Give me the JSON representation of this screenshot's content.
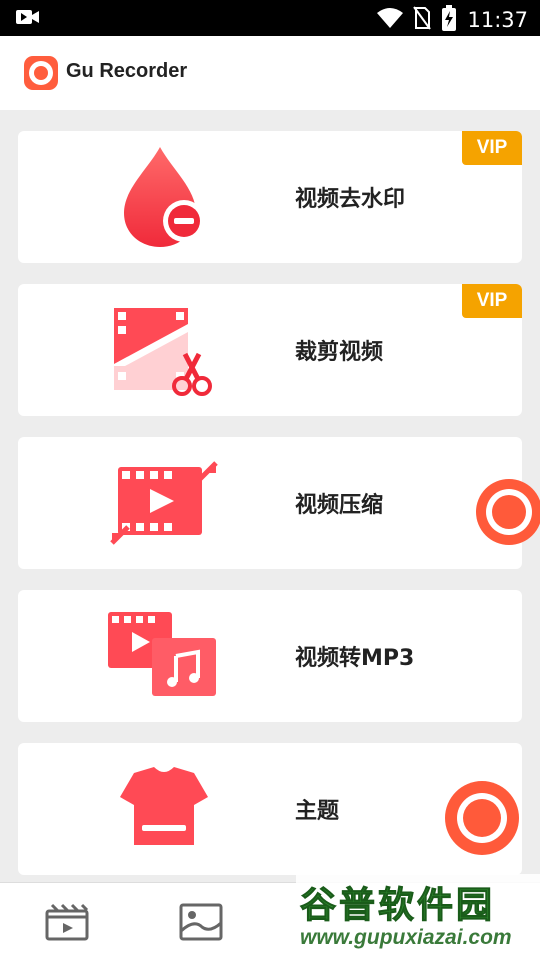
{
  "status_bar": {
    "time": "11:37"
  },
  "app": {
    "title": "Gu Recorder"
  },
  "features": [
    {
      "label": "视频去水印",
      "vip": "VIP",
      "icon": "watermark-remove-icon"
    },
    {
      "label": "裁剪视频",
      "vip": "VIP",
      "icon": "video-crop-icon"
    },
    {
      "label": "视频压缩",
      "icon": "video-compress-icon"
    },
    {
      "label": "视频转MP3",
      "icon": "video-to-mp3-icon"
    },
    {
      "label": "主题",
      "icon": "theme-shirt-icon"
    }
  ],
  "bottom_nav": {
    "items": [
      "video-icon",
      "image-icon"
    ]
  },
  "watermark": {
    "title": "谷普软件园",
    "url": "www.gupuxiazai.com"
  },
  "colors": {
    "accent": "#ff4a4f",
    "vip": "#f5a300",
    "record": "#ff5a3a"
  }
}
